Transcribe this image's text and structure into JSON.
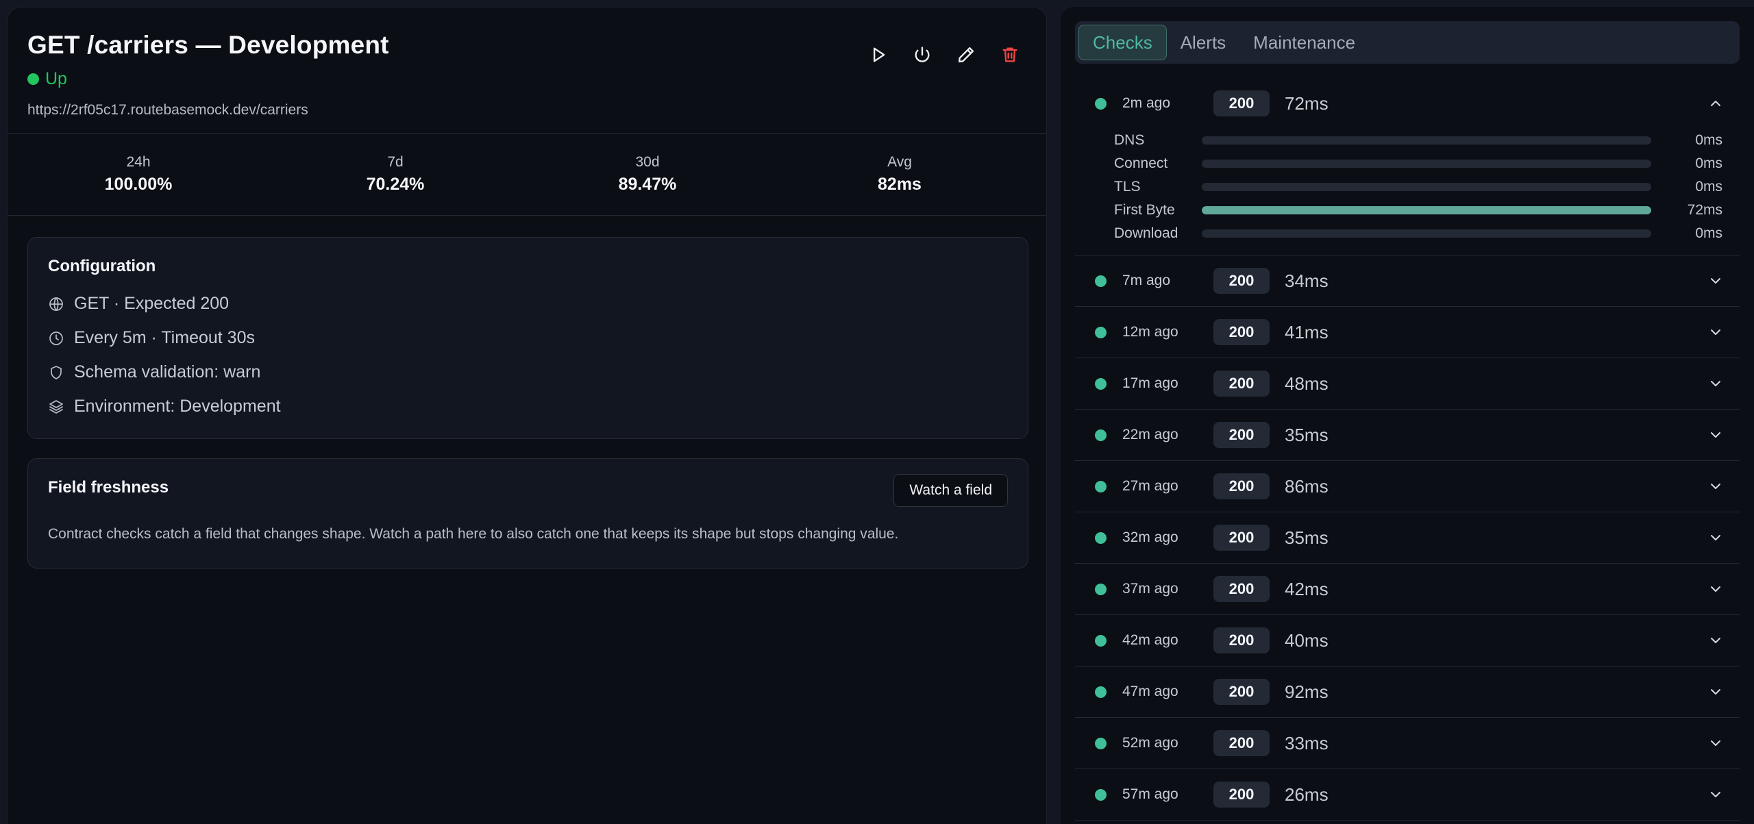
{
  "monitor": {
    "title": "GET /carriers — Development",
    "status": "Up",
    "url": "https://2rf05c17.routebasemock.dev/carriers"
  },
  "actions": [
    "run-now",
    "pause",
    "edit",
    "delete"
  ],
  "stats": [
    {
      "label": "24h",
      "value": "100.00%"
    },
    {
      "label": "7d",
      "value": "70.24%"
    },
    {
      "label": "30d",
      "value": "89.47%"
    },
    {
      "label": "Avg",
      "value": "82ms"
    }
  ],
  "config": {
    "title": "Configuration",
    "rows": [
      {
        "icon": "globe-icon",
        "text": "GET · Expected 200"
      },
      {
        "icon": "clock-icon",
        "text": "Every 5m · Timeout 30s"
      },
      {
        "icon": "shield-icon",
        "text": "Schema validation: warn"
      },
      {
        "icon": "layers-icon",
        "text": "Environment: Development"
      }
    ]
  },
  "freshness": {
    "title": "Field freshness",
    "button": "Watch a field",
    "description": "Contract checks catch a field that changes shape. Watch a path here to also catch one that keeps its shape but stops changing value."
  },
  "tabs": [
    {
      "label": "Checks",
      "active": true
    },
    {
      "label": "Alerts",
      "active": false
    },
    {
      "label": "Maintenance",
      "active": false
    }
  ],
  "colors": {
    "up": "#22c55e",
    "accent": "#4fb8a4",
    "danger": "#ef4444"
  },
  "checks": [
    {
      "time": "2m ago",
      "code": "200",
      "ms": "72ms",
      "expanded": true,
      "timing": [
        {
          "label": "DNS",
          "value": "0ms",
          "fraction": 0
        },
        {
          "label": "Connect",
          "value": "0ms",
          "fraction": 0
        },
        {
          "label": "TLS",
          "value": "0ms",
          "fraction": 0
        },
        {
          "label": "First Byte",
          "value": "72ms",
          "fraction": 1
        },
        {
          "label": "Download",
          "value": "0ms",
          "fraction": 0
        }
      ]
    },
    {
      "time": "7m ago",
      "code": "200",
      "ms": "34ms"
    },
    {
      "time": "12m ago",
      "code": "200",
      "ms": "41ms"
    },
    {
      "time": "17m ago",
      "code": "200",
      "ms": "48ms"
    },
    {
      "time": "22m ago",
      "code": "200",
      "ms": "35ms"
    },
    {
      "time": "27m ago",
      "code": "200",
      "ms": "86ms"
    },
    {
      "time": "32m ago",
      "code": "200",
      "ms": "35ms"
    },
    {
      "time": "37m ago",
      "code": "200",
      "ms": "42ms"
    },
    {
      "time": "42m ago",
      "code": "200",
      "ms": "40ms"
    },
    {
      "time": "47m ago",
      "code": "200",
      "ms": "92ms"
    },
    {
      "time": "52m ago",
      "code": "200",
      "ms": "33ms"
    },
    {
      "time": "57m ago",
      "code": "200",
      "ms": "26ms"
    }
  ]
}
